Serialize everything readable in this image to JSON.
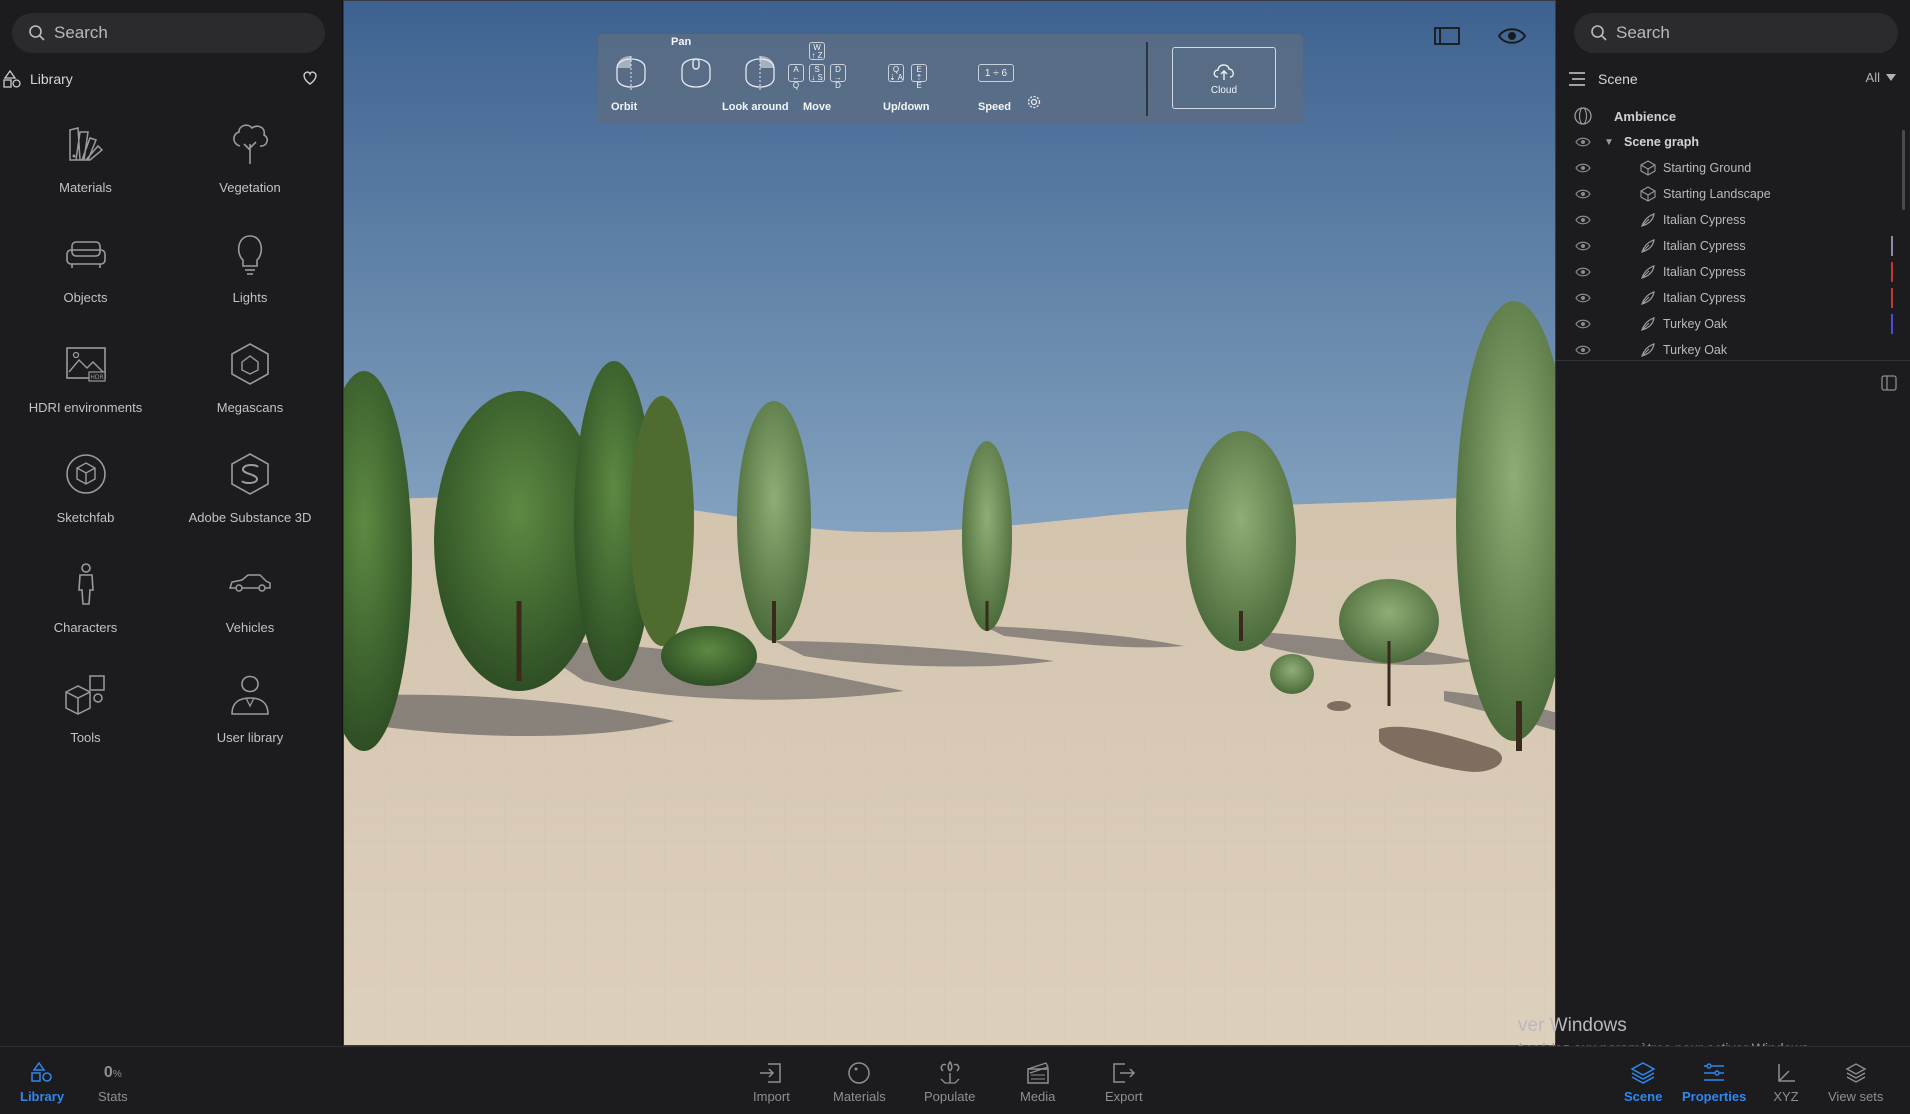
{
  "left_panel": {
    "search_placeholder": "Search",
    "library_title": "Library",
    "items": [
      {
        "label": "Materials",
        "icon": "materials-fan-icon"
      },
      {
        "label": "Vegetation",
        "icon": "tree-icon"
      },
      {
        "label": "Objects",
        "icon": "sofa-icon"
      },
      {
        "label": "Lights",
        "icon": "lightbulb-icon"
      },
      {
        "label": "HDRI environments",
        "icon": "hdri-icon"
      },
      {
        "label": "Megascans",
        "icon": "megascans-icon"
      },
      {
        "label": "Sketchfab",
        "icon": "sketchfab-icon"
      },
      {
        "label": "Adobe Substance 3D",
        "icon": "substance-icon"
      },
      {
        "label": "Characters",
        "icon": "person-icon"
      },
      {
        "label": "Vehicles",
        "icon": "car-icon"
      },
      {
        "label": "Tools",
        "icon": "tools-boxes-icon"
      },
      {
        "label": "User library",
        "icon": "user-icon"
      }
    ]
  },
  "hud": {
    "orbit": "Orbit",
    "pan": "Pan",
    "look_around": "Look around",
    "move": "Move",
    "up_down": "Up/down",
    "speed": "Speed",
    "speed_keys": "1 ÷ 6",
    "cloud": "Cloud",
    "keys": {
      "w": "W",
      "w_sub": "↑ Z",
      "a": "A",
      "a_sub": "← Q",
      "s": "S",
      "s_sub": "↓ S",
      "d": "D",
      "d_sub": "→ D",
      "q": "Q",
      "q_sub": "⇣ A",
      "e": "E",
      "e_sub": "⇡ E"
    }
  },
  "right_panel": {
    "search_placeholder": "Search",
    "scene_title": "Scene",
    "filter": "All",
    "ambience": "Ambience",
    "scene_graph": "Scene graph",
    "nodes": [
      {
        "label": "Starting Ground",
        "type": "landscape"
      },
      {
        "label": "Starting Landscape",
        "type": "landscape"
      },
      {
        "label": "Italian Cypress",
        "type": "vegetation",
        "bar": ""
      },
      {
        "label": "Italian Cypress",
        "type": "vegetation",
        "bar": "#8a8ab0"
      },
      {
        "label": "Italian Cypress",
        "type": "vegetation",
        "bar": "#c0392b"
      },
      {
        "label": "Italian Cypress",
        "type": "vegetation",
        "bar": "#c0392b"
      },
      {
        "label": "Turkey Oak",
        "type": "vegetation",
        "bar": "#4b4be0"
      },
      {
        "label": "Turkey Oak",
        "type": "vegetation",
        "bar": ""
      }
    ]
  },
  "watermark": {
    "line1": "ver Windows",
    "line2": "Accédez aux paramètres pour activer Windows."
  },
  "bottom_bar": {
    "library": "Library",
    "stats_value": "0",
    "stats_unit": "%",
    "stats": "Stats",
    "import": "Import",
    "materials": "Materials",
    "populate": "Populate",
    "media": "Media",
    "export": "Export",
    "scene": "Scene",
    "properties": "Properties",
    "xyz": "XYZ",
    "view_sets": "View sets"
  },
  "colors": {
    "accent": "#2f87f0",
    "panel_bg": "#1c1c1f",
    "sky_top": "#3f6390",
    "sand": "#d6c9b4"
  }
}
